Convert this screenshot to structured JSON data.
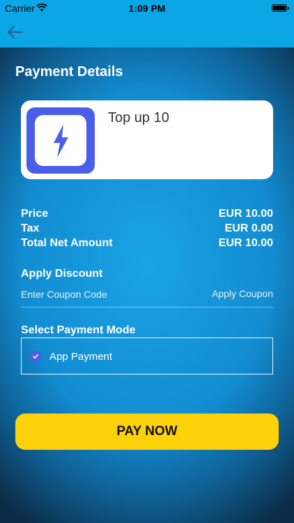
{
  "status_bar": {
    "carrier": "Carrier",
    "time": "1:09 PM"
  },
  "colors": {
    "header": "#0aa6e6",
    "accent": "#4a5ee8",
    "pay_button": "#fdd20a"
  },
  "page": {
    "title": "Payment Details"
  },
  "product": {
    "name": "Top up 10",
    "icon": "lightning-bolt-icon"
  },
  "summary": {
    "price_label": "Price",
    "price_value": "EUR 10.00",
    "tax_label": "Tax",
    "tax_value": "EUR 0.00",
    "total_label": "Total Net Amount",
    "total_value": "EUR 10.00"
  },
  "discount": {
    "title": "Apply Discount",
    "placeholder": "Enter Coupon Code",
    "apply_label": "Apply Coupon"
  },
  "payment_mode": {
    "title": "Select Payment Mode",
    "option_label": "App Payment",
    "selected": true
  },
  "pay_button": {
    "label": "PAY NOW"
  }
}
